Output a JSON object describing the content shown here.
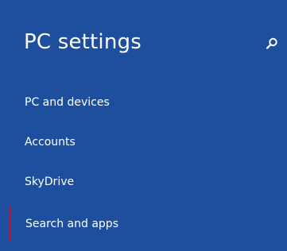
{
  "header": {
    "title": "PC settings",
    "search_icon": "search-icon"
  },
  "nav": {
    "items": [
      {
        "label": "PC and devices",
        "selected": false
      },
      {
        "label": "Accounts",
        "selected": false
      },
      {
        "label": "SkyDrive",
        "selected": false
      },
      {
        "label": "Search and apps",
        "selected": true
      }
    ]
  },
  "colors": {
    "background": "#1E4F9E",
    "text": "#FFFFFF",
    "selection_outline": "#C8102E"
  }
}
